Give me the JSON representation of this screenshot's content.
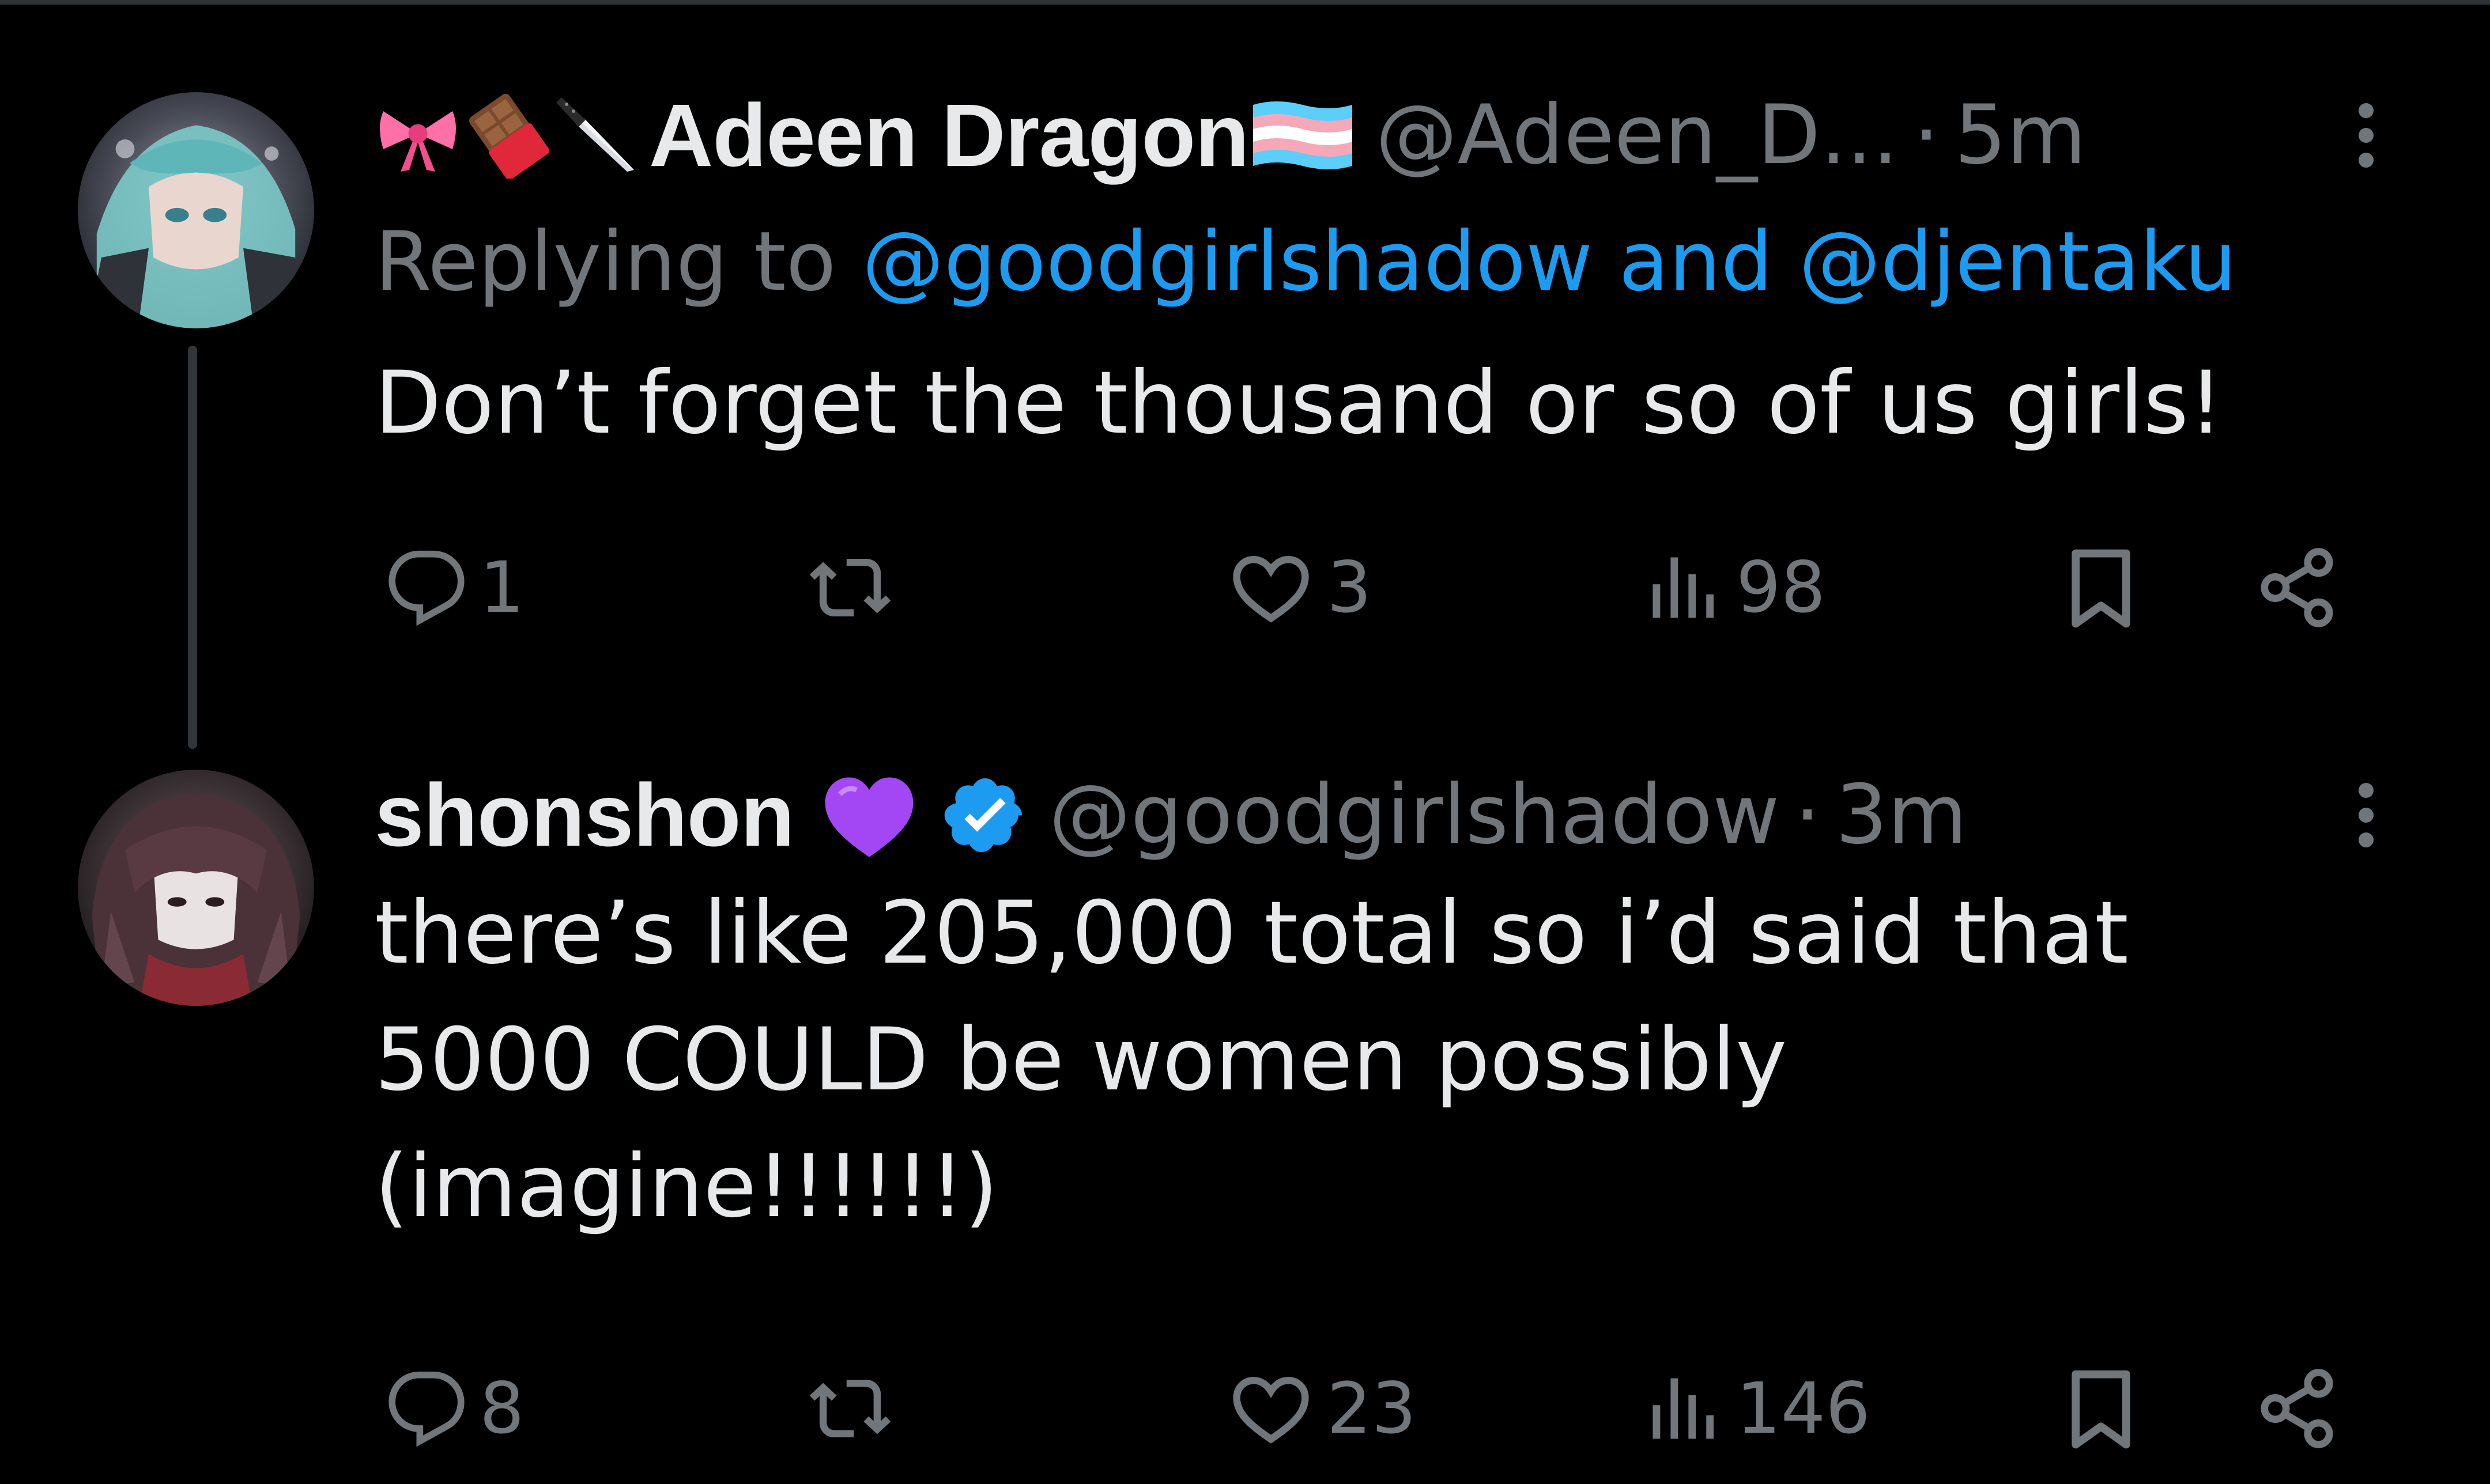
{
  "colors": {
    "background": "#000000",
    "text_primary": "#e7e9ea",
    "text_secondary": "#71767b",
    "link": "#1d9bf0",
    "verified": "#1d9bf0",
    "thread_line": "#333639"
  },
  "tweets": [
    {
      "display_name": "Adeen Dragon",
      "name_prefix_emojis": [
        "ribbon-emoji",
        "chocolate-bar-emoji",
        "kitchen-knife-emoji"
      ],
      "name_suffix_emoji": "transgender-flag-emoji",
      "handle": "@Adeen_D...",
      "separator": "·",
      "time": "5m",
      "replying_prefix": "Replying to ",
      "replying_user_1": "@goodgirlshadow",
      "replying_and": " and ",
      "replying_user_2": "@djentaku",
      "text": "Don’t forget the thousand or so of us girls!",
      "counts": {
        "replies": "1",
        "retweets": "",
        "likes": "3",
        "views": "98"
      }
    },
    {
      "display_name": "shonshon",
      "name_suffix_emoji": "purple-heart-emoji",
      "verified": true,
      "handle": "@goodgirlshadow",
      "separator": "·",
      "time": "3m",
      "text": "there’s like 205,000 total so i’d said that\n5000 COULD be women possibly\n(imagine!!!!!!)",
      "counts": {
        "replies": "8",
        "retweets": "",
        "likes": "23",
        "views": "146"
      }
    }
  ]
}
